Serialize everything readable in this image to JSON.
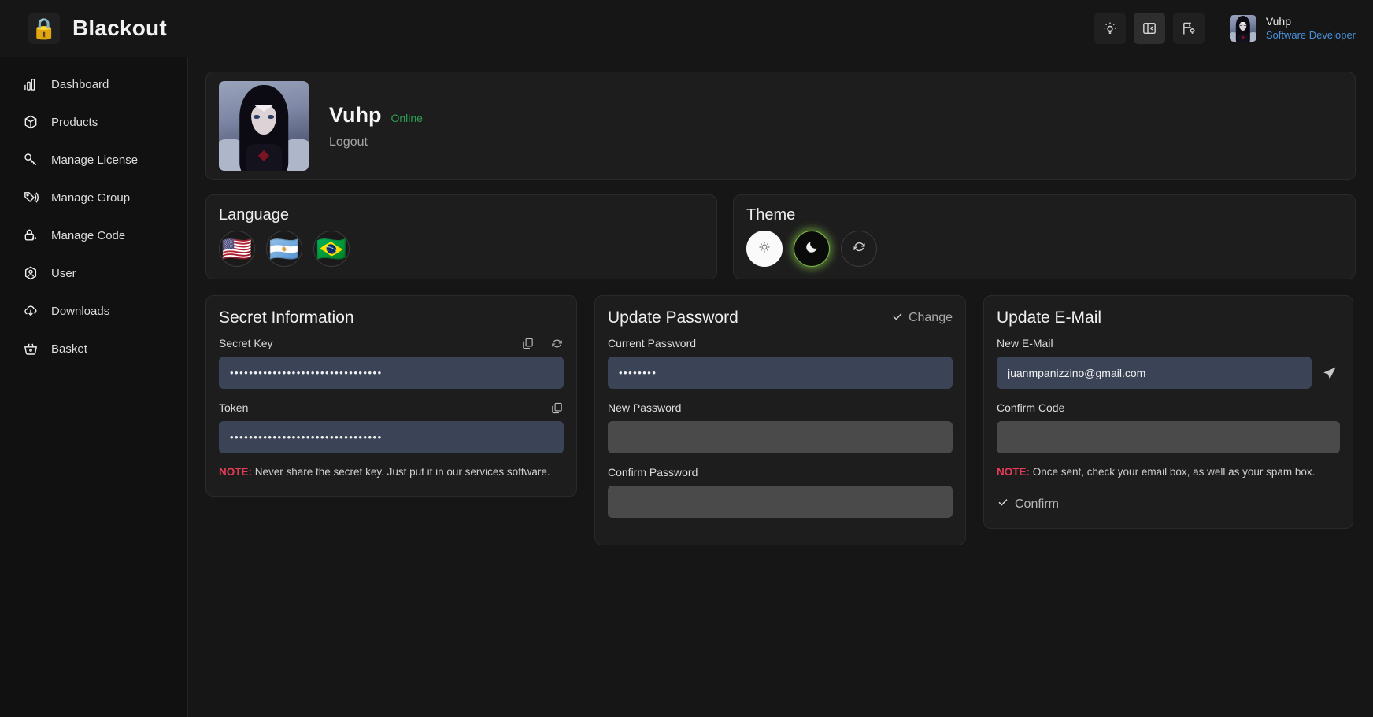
{
  "app": {
    "name": "Blackout",
    "logo_icon": "padlock-icon"
  },
  "header": {
    "icons": [
      {
        "name": "lightbulb-icon",
        "label": "Tips"
      },
      {
        "name": "sidebar-toggle-icon",
        "label": "Toggle sidebar"
      },
      {
        "name": "flag-settings-icon",
        "label": "Flag settings"
      }
    ],
    "user": {
      "name": "Vuhp",
      "role": "Software Developer",
      "role_color": "#4a90d9",
      "avatar_icon": "user-avatar"
    }
  },
  "sidebar": {
    "items": [
      {
        "label": "Dashboard",
        "icon": "bar-chart-icon"
      },
      {
        "label": "Products",
        "icon": "box-icon"
      },
      {
        "label": "Manage License",
        "icon": "key-icon"
      },
      {
        "label": "Manage Group",
        "icon": "tags-icon"
      },
      {
        "label": "Manage Code",
        "icon": "lock-code-icon"
      },
      {
        "label": "User",
        "icon": "user-hexagon-icon"
      },
      {
        "label": "Downloads",
        "icon": "cloud-download-icon"
      },
      {
        "label": "Basket",
        "icon": "basket-icon"
      }
    ]
  },
  "profile": {
    "name": "Vuhp",
    "status": "Online",
    "status_color": "#2e9e54",
    "logout_label": "Logout",
    "avatar_icon": "profile-avatar"
  },
  "language": {
    "title": "Language",
    "options": [
      {
        "name": "flag-us",
        "glyph": "🇺🇸",
        "label": "United States"
      },
      {
        "name": "flag-argentina",
        "glyph": "🇦🇷",
        "label": "Argentina"
      },
      {
        "name": "flag-brazil",
        "glyph": "🇧🇷",
        "label": "Brazil"
      }
    ]
  },
  "theme": {
    "title": "Theme",
    "selected": "dark",
    "accent_color": "#7ab648",
    "options": [
      {
        "name": "theme-light-button",
        "icon": "sun-gear-icon",
        "label": "Light"
      },
      {
        "name": "theme-dark-button",
        "icon": "moon-icon",
        "label": "Dark"
      },
      {
        "name": "theme-reset-button",
        "icon": "refresh-icon",
        "label": "Reset"
      }
    ]
  },
  "secret_information": {
    "title": "Secret Information",
    "secret_key": {
      "label": "Secret Key",
      "value": "••••••••••••••••••••••••••••••••",
      "placeholder": "",
      "actions": [
        {
          "name": "copy-secret-key-icon",
          "icon": "copy-icon"
        },
        {
          "name": "regenerate-secret-key-icon",
          "icon": "refresh-icon"
        }
      ]
    },
    "token": {
      "label": "Token",
      "value": "••••••••••••••••••••••••••••••••",
      "placeholder": "",
      "actions": [
        {
          "name": "copy-token-icon",
          "icon": "copy-icon"
        }
      ]
    },
    "note_prefix": "NOTE:",
    "note_text": " Never share the secret key. Just put it in our services software.",
    "note_color": "#e43b57"
  },
  "update_password": {
    "title": "Update Password",
    "change_label": "Change",
    "change_icon": "check-icon",
    "fields": [
      {
        "label": "Current Password",
        "value": "••••••••",
        "placeholder": "",
        "filled": true
      },
      {
        "label": "New Password",
        "value": "",
        "placeholder": "",
        "filled": false
      },
      {
        "label": "Confirm Password",
        "value": "",
        "placeholder": "",
        "filled": false
      }
    ]
  },
  "update_email": {
    "title": "Update E-Mail",
    "new_email": {
      "label": "New E-Mail",
      "value": "juanmpanizzino@gmail.com",
      "placeholder": ""
    },
    "send_icon": "send-plane-icon",
    "confirm_code": {
      "label": "Confirm Code",
      "value": "",
      "placeholder": ""
    },
    "note_prefix": "NOTE:",
    "note_text": " Once sent, check your email box, as well as your spam box.",
    "confirm_label": "Confirm",
    "confirm_icon": "check-icon"
  }
}
